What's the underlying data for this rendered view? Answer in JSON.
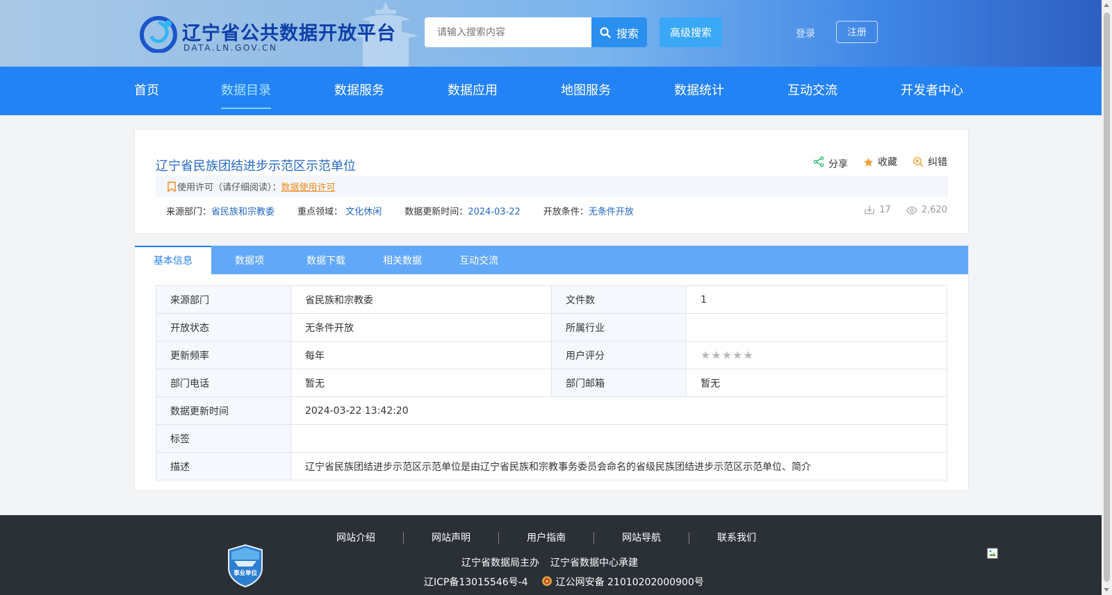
{
  "header": {
    "logo_title": "辽宁省公共数据开放平台",
    "logo_subtitle": "DATA.LN.GOV.CN",
    "search_placeholder": "请输入搜索内容",
    "search_button": "搜索",
    "advanced_search": "高级搜索",
    "login": "登录",
    "register": "注册"
  },
  "nav": {
    "items": [
      {
        "label": "首页"
      },
      {
        "label": "数据目录",
        "active": true
      },
      {
        "label": "数据服务"
      },
      {
        "label": "数据应用"
      },
      {
        "label": "地图服务"
      },
      {
        "label": "数据统计"
      },
      {
        "label": "互动交流"
      },
      {
        "label": "开发者中心"
      }
    ]
  },
  "dataset": {
    "title": "辽宁省民族团结进步示范区示范单位",
    "actions": {
      "share": "分享",
      "favorite": "收藏",
      "correct": "纠错"
    },
    "license_label": "使用许可（请仔细阅读）：",
    "license_link": "数据使用许可",
    "meta": {
      "source_label": "来源部门：",
      "source_value": "省民族和宗教委",
      "domain_label": "重点领域：",
      "domain_value": "文化休闲",
      "updated_label": "数据更新时间：",
      "updated_value": "2024-03-22",
      "open_label": "开放条件：",
      "open_value": "无条件开放"
    },
    "downloads": "17",
    "views": "2,620"
  },
  "tabs": [
    {
      "label": "基本信息",
      "active": true
    },
    {
      "label": "数据项"
    },
    {
      "label": "数据下载"
    },
    {
      "label": "相关数据"
    },
    {
      "label": "互动交流"
    }
  ],
  "details": {
    "source_dept_label": "来源部门",
    "source_dept_value": "省民族和宗教委",
    "file_count_label": "文件数",
    "file_count_value": "1",
    "open_status_label": "开放状态",
    "open_status_value": "无条件开放",
    "industry_label": "所属行业",
    "industry_value": "",
    "frequency_label": "更新频率",
    "frequency_value": "每年",
    "rating_label": "用户评分",
    "rating_value": 0,
    "rating_max": 5,
    "phone_label": "部门电话",
    "phone_value": "暂无",
    "email_label": "部门邮箱",
    "email_value": "暂无",
    "update_time_label": "数据更新时间",
    "update_time_value": "2024-03-22 13:42:20",
    "tags_label": "标签",
    "tags_value": "",
    "desc_label": "描述",
    "desc_value": "辽宁省民族团结进步示范区示范单位是由辽宁省民族和宗教事务委员会命名的省级民族团结进步示范区示范单位、简介"
  },
  "footer": {
    "links": [
      {
        "label": "网站介绍"
      },
      {
        "label": "网站声明"
      },
      {
        "label": "用户指南"
      },
      {
        "label": "网站导航"
      },
      {
        "label": "联系我们"
      }
    ],
    "host": "辽宁省数据局主办",
    "builder": "辽宁省数据中心承建",
    "icp": "辽ICP备13015546号-4",
    "police": "辽公网安备 21010202000900号",
    "badge_text": "事业单位"
  },
  "colors": {
    "primary": "#2383f5",
    "tab_bar": "#62a8f8",
    "link_blue": "#2569c4",
    "license_orange": "#f08a1c",
    "footer_bg": "#2b2f36"
  }
}
